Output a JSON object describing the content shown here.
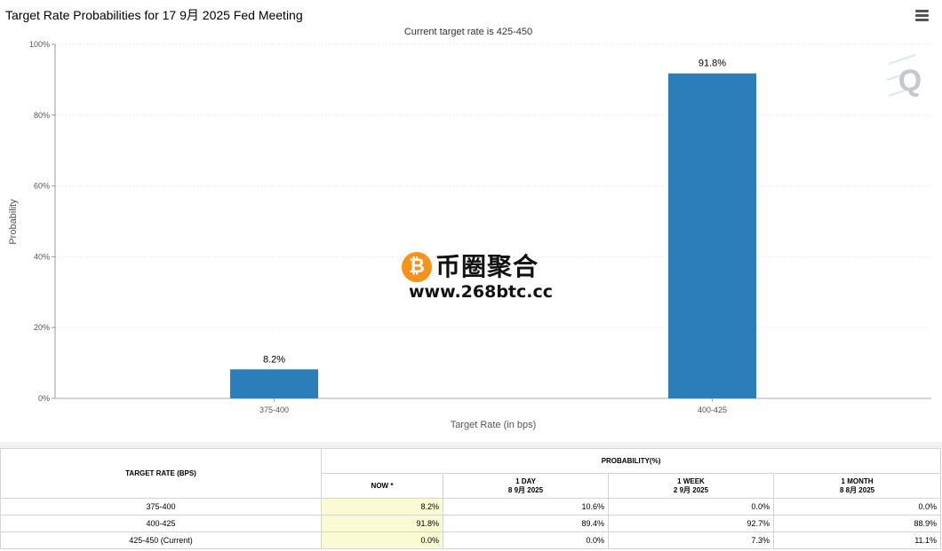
{
  "header": {
    "title": "Target Rate Probabilities for 17 9月 2025 Fed Meeting",
    "menu_icon": "hamburger-menu-icon"
  },
  "chart_data": {
    "type": "bar",
    "subtitle": "Current target rate is 425-450",
    "xlabel": "Target Rate (in bps)",
    "ylabel": "Probability",
    "categories": [
      "375-400",
      "400-425"
    ],
    "values": [
      8.2,
      91.8
    ],
    "data_labels": [
      "8.2%",
      "91.8%"
    ],
    "ylim": [
      0,
      100
    ],
    "yticks": [
      0,
      20,
      40,
      60,
      80,
      100
    ],
    "ytick_labels": [
      "0%",
      "20%",
      "40%",
      "60%",
      "80%",
      "100%"
    ],
    "grid": true,
    "bar_color": "#2b7eb9"
  },
  "watermark": {
    "coin_symbol": "₿",
    "name": "币圈聚合",
    "url": "www.268btc.cc",
    "corner_logo": "Q"
  },
  "table": {
    "target_rate_header": "TARGET RATE (BPS)",
    "probability_header": "PROBABILITY(%)",
    "columns": [
      {
        "label": "NOW *",
        "date": ""
      },
      {
        "label": "1 DAY",
        "date": "8 9月 2025"
      },
      {
        "label": "1 WEEK",
        "date": "2 9月 2025"
      },
      {
        "label": "1 MONTH",
        "date": "8 8月 2025"
      }
    ],
    "rows": [
      {
        "rate": "375-400",
        "values": [
          "8.2%",
          "10.6%",
          "0.0%",
          "0.0%"
        ]
      },
      {
        "rate": "400-425",
        "values": [
          "91.8%",
          "89.4%",
          "92.7%",
          "88.9%"
        ]
      },
      {
        "rate": "425-450 (Current)",
        "values": [
          "0.0%",
          "0.0%",
          "7.3%",
          "11.1%"
        ]
      }
    ]
  }
}
